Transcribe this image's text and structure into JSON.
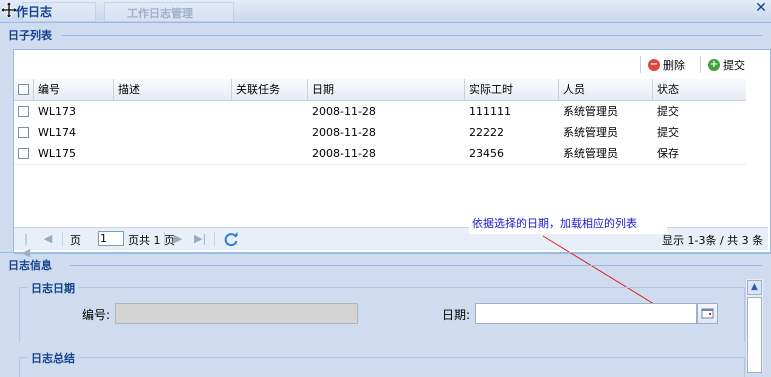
{
  "window": {
    "title": "作日志",
    "background_tab_label": "工作日志管理"
  },
  "list_panel": {
    "title": "日子列表",
    "toolbar": {
      "delete_label": "删除",
      "submit_label": "提交"
    },
    "columns": [
      "编号",
      "描述",
      "关联任务",
      "日期",
      "实际工时",
      "人员",
      "状态"
    ],
    "rows": [
      {
        "id": "WL173",
        "desc": "",
        "task": "",
        "date": "2008-11-28",
        "hours": "111111",
        "person": "系统管理员",
        "status": "提交"
      },
      {
        "id": "WL174",
        "desc": "",
        "task": "",
        "date": "2008-11-28",
        "hours": "22222",
        "person": "系统管理员",
        "status": "提交"
      },
      {
        "id": "WL175",
        "desc": "",
        "task": "",
        "date": "2008-11-28",
        "hours": "23456",
        "person": "系统管理员",
        "status": "保存"
      }
    ],
    "pager": {
      "page_prefix": "页",
      "page_value": "1",
      "page_suffix": "页共 1 页",
      "display_info": "显示 1-3条 / 共 3 条"
    }
  },
  "annotation": {
    "text": "依据选择的日期，加载相应的列表"
  },
  "detail_panel": {
    "title": "日志信息",
    "date_section": {
      "legend": "日志日期",
      "id_label": "编号:",
      "id_value": "",
      "date_label": "日期:",
      "date_value": ""
    },
    "summary_section": {
      "legend": "日志总结"
    }
  },
  "colors": {
    "accent": "#15428b",
    "border": "#99bbe8",
    "delete_icon": "#e0463b",
    "submit_icon": "#3fa33a",
    "annotation_text": "#1a1ad0",
    "annotation_line": "#e02020"
  }
}
